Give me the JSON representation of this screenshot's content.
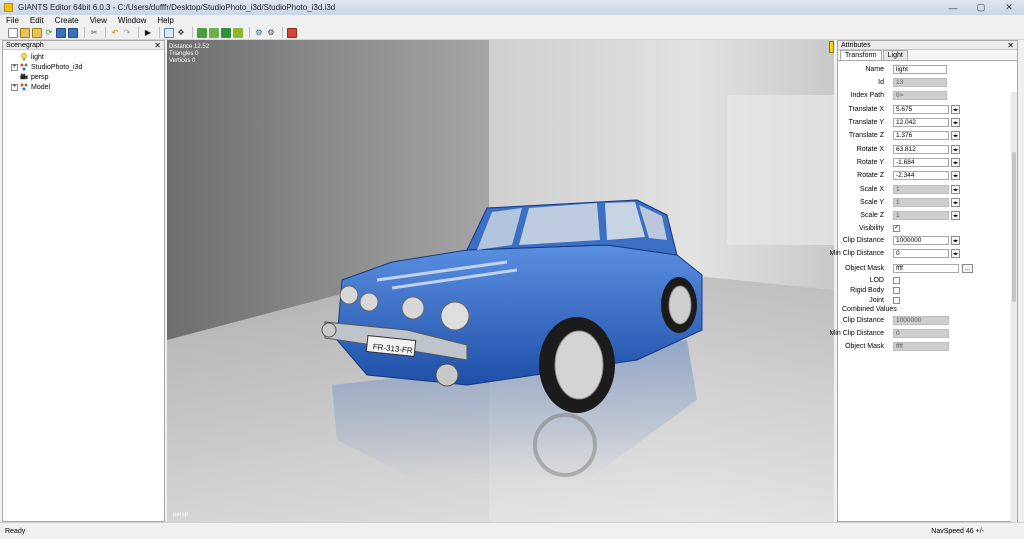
{
  "window": {
    "title": "GIANTS Editor 64bit 6.0.3 - C:/Users/dufffr/Desktop/StudioPhoto_i3d/StudioPhoto_i3d.i3d",
    "minimize_glyph": "—",
    "maximize_glyph": "▢",
    "close_glyph": "✕"
  },
  "menu": [
    "File",
    "Edit",
    "Create",
    "View",
    "Window",
    "Help"
  ],
  "scenegraph": {
    "title": "Scenegraph",
    "close_glyph": "✕",
    "items": [
      {
        "label": "light",
        "icon": "lightbulb-icon",
        "expandable": false
      },
      {
        "label": "StudioPhoto_i3d",
        "icon": "transform-group-icon",
        "expandable": true
      },
      {
        "label": "persp",
        "icon": "camera-icon",
        "expandable": false
      },
      {
        "label": "Model",
        "icon": "transform-group-icon",
        "expandable": true
      }
    ]
  },
  "viewport": {
    "distance": "Distance 12.52",
    "triangles": "Triangles 0",
    "vertices": "Vertices 0",
    "camera": "persp",
    "license_plate": "FR-313-FR"
  },
  "attributes": {
    "title": "Attributes",
    "close_glyph": "✕",
    "tabs": [
      "Transform",
      "Light"
    ],
    "fields": {
      "name": {
        "label": "Name",
        "value": "light"
      },
      "id": {
        "label": "Id",
        "value": "13"
      },
      "index_path": {
        "label": "Index Path",
        "value": "0>"
      },
      "translate_x": {
        "label": "Translate X",
        "value": "5.675"
      },
      "translate_y": {
        "label": "Translate Y",
        "value": "12.042"
      },
      "translate_z": {
        "label": "Translate Z",
        "value": "1.376"
      },
      "rotate_x": {
        "label": "Rotate X",
        "value": "63.812"
      },
      "rotate_y": {
        "label": "Rotate Y",
        "value": "-1.684"
      },
      "rotate_z": {
        "label": "Rotate Z",
        "value": "-2.344"
      },
      "scale_x": {
        "label": "Scale X",
        "value": "1"
      },
      "scale_y": {
        "label": "Scale Y",
        "value": "1"
      },
      "scale_z": {
        "label": "Scale Z",
        "value": "1"
      },
      "visibility": {
        "label": "Visibility",
        "checked": true
      },
      "clip_distance": {
        "label": "Clip Distance",
        "value": "1000000"
      },
      "min_clip_distance": {
        "label": "Min Clip Distance",
        "value": "0"
      },
      "object_mask": {
        "label": "Object Mask",
        "value": "ffff",
        "button": "..."
      },
      "lod": {
        "label": "LOD",
        "checked": false
      },
      "rigid_body": {
        "label": "Rigid Body",
        "checked": false
      },
      "joint": {
        "label": "Joint",
        "checked": false
      }
    },
    "combined_values_label": "Combined Values",
    "combined": {
      "clip_distance": {
        "label": "Clip Distance",
        "value": "1000000"
      },
      "min_clip_distance": {
        "label": "Min Clip Distance",
        "value": "0"
      },
      "object_mask": {
        "label": "Object Mask",
        "value": "ffff"
      }
    },
    "stepper_glyph": "◂▸",
    "check_glyph": "✓"
  },
  "status": {
    "left": "Ready",
    "right": "NavSpeed 46 +/-"
  }
}
